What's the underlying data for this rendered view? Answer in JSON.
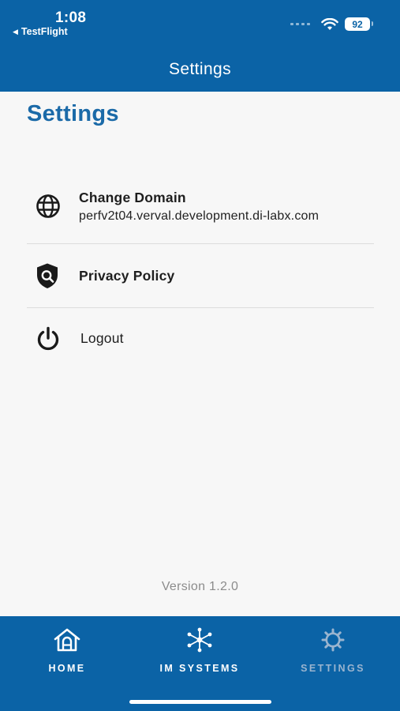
{
  "status_bar": {
    "time": "1:08",
    "back_app": "TestFlight",
    "battery": "92"
  },
  "header": {
    "title": "Settings"
  },
  "page": {
    "title": "Settings"
  },
  "settings": {
    "change_domain": {
      "label": "Change Domain",
      "value": "perfv2t04.verval.development.di-labx.com",
      "icon": "globe-icon"
    },
    "privacy_policy": {
      "label": "Privacy Policy",
      "icon": "shield-search-icon"
    },
    "logout": {
      "label": "Logout",
      "icon": "power-icon"
    }
  },
  "footer": {
    "version": "Version 1.2.0"
  },
  "tabbar": {
    "tabs": [
      {
        "label": "HOME",
        "icon": "home-icon",
        "active": false
      },
      {
        "label": "IM SYSTEMS",
        "icon": "network-icon",
        "active": false
      },
      {
        "label": "SETTINGS",
        "icon": "gear-icon",
        "active": true
      }
    ]
  },
  "colors": {
    "brand_blue": "#0b63a6",
    "title_blue": "#1b6aa8",
    "inactive_tab": "#9ab4cf",
    "version_gray": "#8c8c8c"
  }
}
